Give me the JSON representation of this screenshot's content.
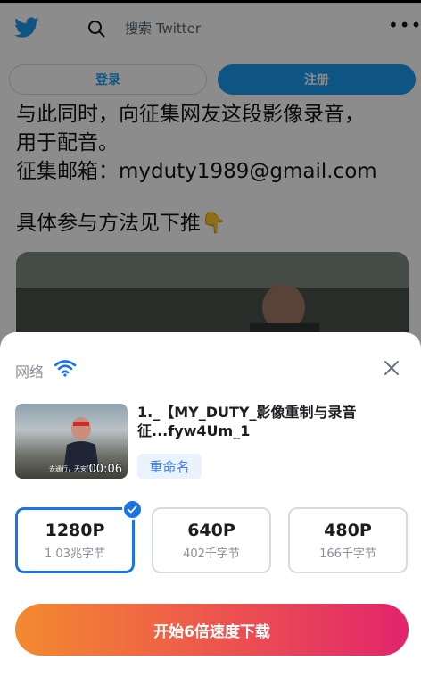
{
  "colors": {
    "twitter_blue": "#1d9bf0",
    "accent_blue": "#1a73e8",
    "download_gradient_start": "#f38a2f",
    "download_gradient_end": "#e2246c"
  },
  "twitter": {
    "search_placeholder": "搜索 Twitter",
    "more_label": "•••",
    "login_label": "登录",
    "register_label": "注册",
    "tweet_lines": [
      "与此同时，向征集网友这段影像录音，",
      "用于配音。",
      "征集邮箱：myduty1989@gmail.com",
      "具体参与方法见下推👇"
    ]
  },
  "sheet": {
    "network_label": "网络",
    "network_icon": "wifi-icon",
    "video": {
      "title_line1": "1._【MY_DUTY_影像重制与录音",
      "title_line2": "征...fyw4Um_1",
      "duration": "00:06",
      "thumbnail_caption": "去通行，天安门 ..."
    },
    "rename_label": "重命名",
    "qualities": [
      {
        "label": "1280P",
        "size": "1.03兆字节",
        "selected": true
      },
      {
        "label": "640P",
        "size": "402千字节",
        "selected": false
      },
      {
        "label": "480P",
        "size": "166千字节",
        "selected": false
      }
    ],
    "download_label": "开始6倍速度下载"
  }
}
